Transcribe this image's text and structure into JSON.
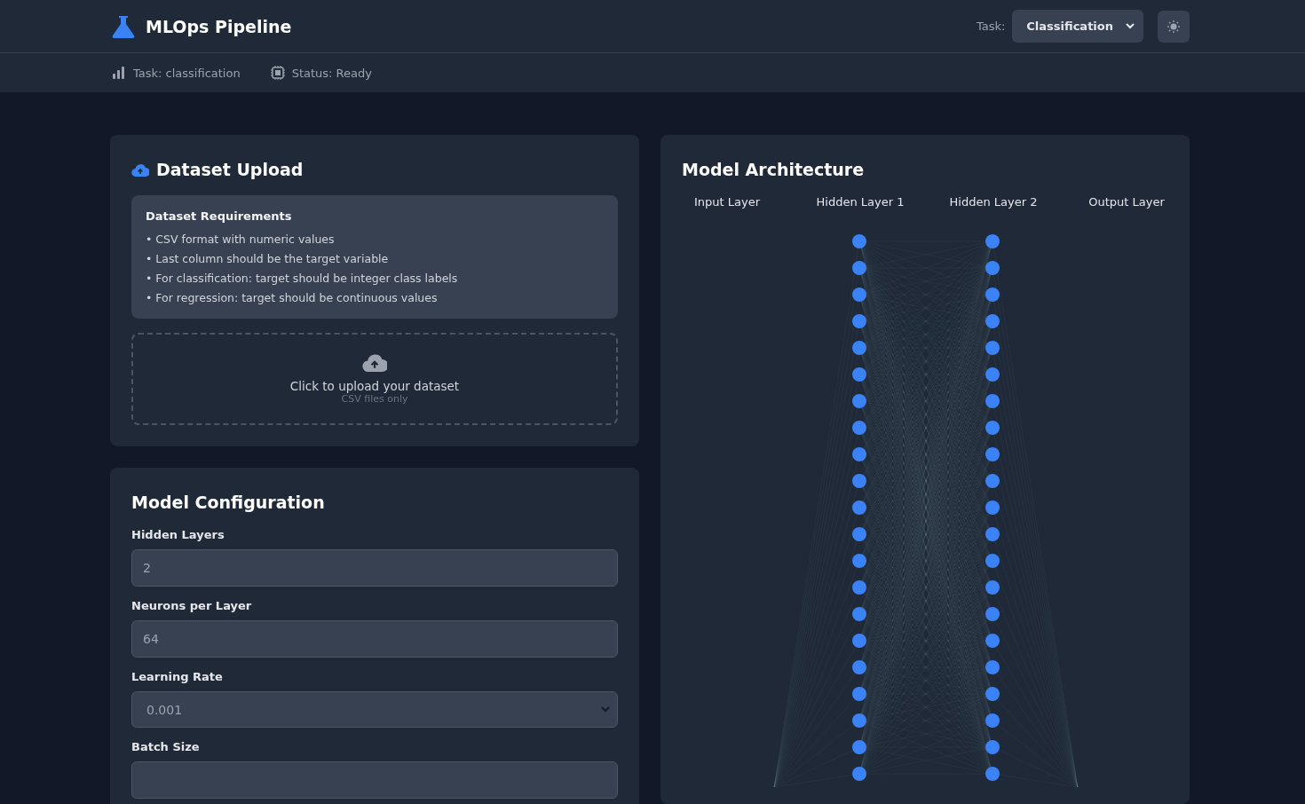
{
  "header": {
    "title": "MLOps Pipeline",
    "task_label": "Task:",
    "task_select": "Classification"
  },
  "status_bar": {
    "task": "Task: classification",
    "status": "Status: Ready"
  },
  "dataset_upload": {
    "title": "Dataset Upload",
    "requirements": {
      "title": "Dataset Requirements",
      "items": [
        "• CSV format with numeric values",
        "• Last column should be the target variable",
        "• For classification: target should be integer class labels",
        "• For regression: target should be continuous values"
      ]
    },
    "dropzone": {
      "text": "Click to upload your dataset",
      "hint": "CSV files only"
    }
  },
  "model_configuration": {
    "title": "Model Configuration",
    "fields": [
      {
        "kind": "input",
        "label": "Hidden Layers",
        "value": "2"
      },
      {
        "kind": "input",
        "label": "Neurons per Layer",
        "value": "64"
      },
      {
        "kind": "select",
        "label": "Learning Rate",
        "value": "0.001"
      },
      {
        "kind": "input",
        "label": "Batch Size"
      }
    ]
  },
  "model_architecture": {
    "title": "Model Architecture",
    "layers": [
      "Input Layer",
      "Hidden Layer 1",
      "Hidden Layer 2",
      "Output Layer"
    ]
  }
}
